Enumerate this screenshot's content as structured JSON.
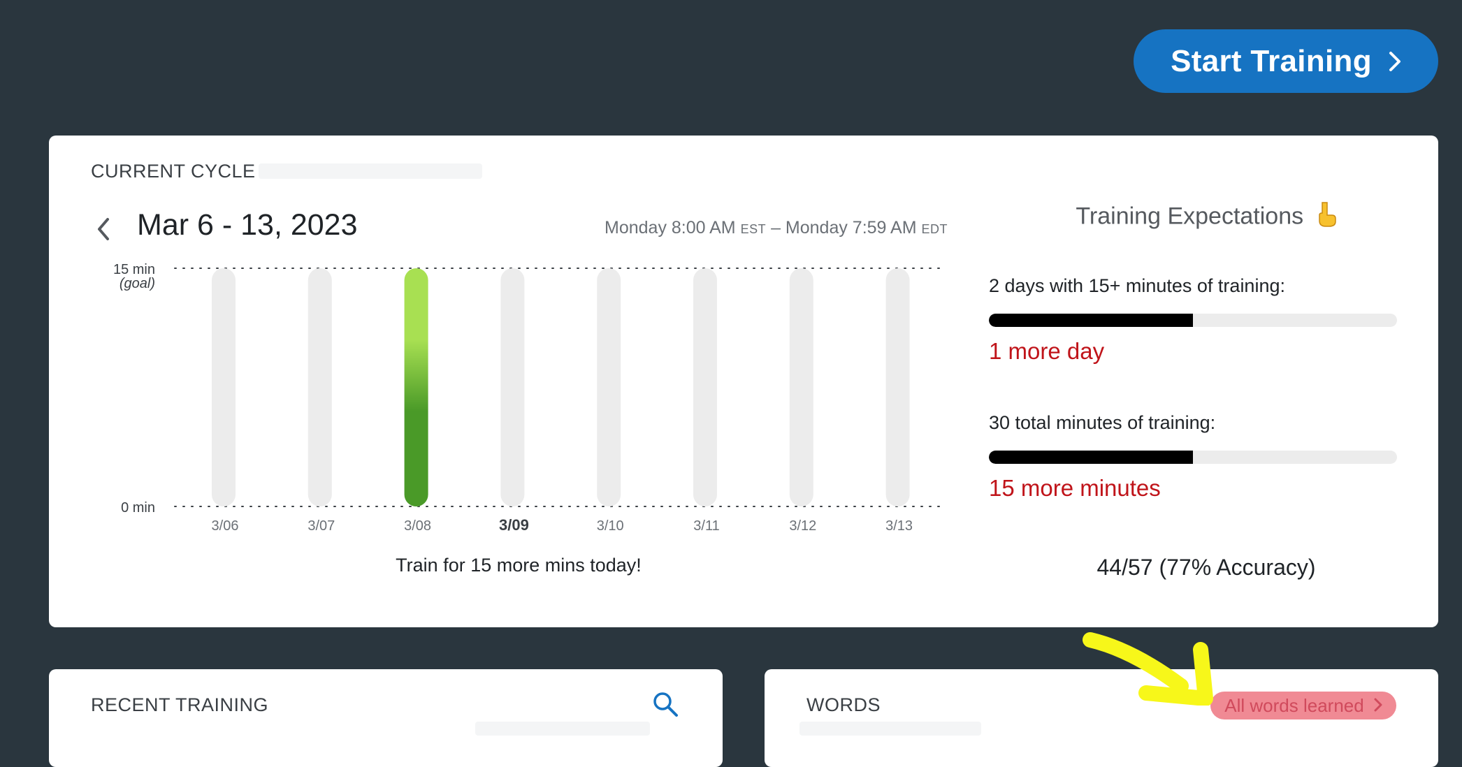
{
  "header": {
    "start_button_label": "Start Training"
  },
  "cycle": {
    "section_title": "CURRENT CYCLE",
    "range_title": "Mar 6 - 13, 2023",
    "start_time": "Monday 8:00 AM",
    "start_tz": "EST",
    "separator": "–",
    "end_time": "Monday 7:59 AM",
    "end_tz": "EDT",
    "today_message": "Train for 15 more mins today!"
  },
  "chart_data": {
    "type": "bar",
    "categories": [
      "3/06",
      "3/07",
      "3/08",
      "3/09",
      "3/10",
      "3/11",
      "3/12",
      "3/13"
    ],
    "values": [
      0,
      0,
      15,
      0,
      0,
      0,
      0,
      0
    ],
    "current_day": "3/09",
    "ylim": [
      0,
      15
    ],
    "y_ticks": [
      {
        "value": 15,
        "label": "15 min",
        "sublabel": "(goal)"
      },
      {
        "value": 0,
        "label": "0 min"
      }
    ],
    "colors": {
      "track": "#ececec",
      "bar_top": "#a8e052",
      "bar_bottom": "#4a9a28",
      "gridline": "#3a3f44"
    }
  },
  "expectations": {
    "title": "Training Expectations",
    "icon": "pointing-down-icon",
    "requirements": [
      {
        "label": "2 days with 15+ minutes of training:",
        "progress": 0.5,
        "remaining": "1 more day"
      },
      {
        "label": "30 total minutes of training:",
        "progress": 0.5,
        "remaining": "15 more minutes"
      }
    ],
    "accuracy": "44/57 (77% Accuracy)"
  },
  "recent": {
    "section_title": "RECENT TRAINING"
  },
  "words": {
    "section_title": "WORDS",
    "all_words_label": "All words learned"
  },
  "colors": {
    "background": "#2a363e",
    "accent": "#1673c2",
    "warning": "#c0141a",
    "highlight": "#f08a94",
    "annotation": "#f7f71a"
  }
}
